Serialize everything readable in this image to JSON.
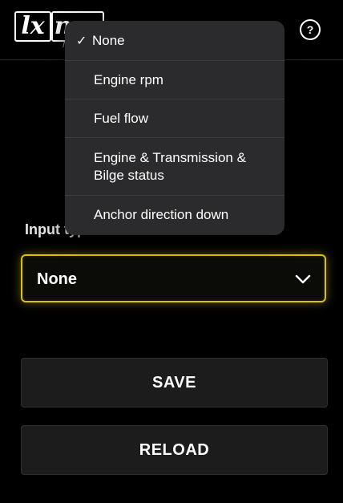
{
  "header": {
    "logo": {
      "primary": "lx",
      "secondary": "nav",
      "sub": "MA"
    },
    "help_icon": "?",
    "accent_color": "#c9a200"
  },
  "menu": {
    "selected_index": 0,
    "check_mark": "✓",
    "items": [
      {
        "label": "None"
      },
      {
        "label": "Engine rpm"
      },
      {
        "label": "Fuel flow"
      },
      {
        "label": "Engine & Transmission & Bilge status"
      },
      {
        "label": "Anchor direction down"
      }
    ]
  },
  "form": {
    "input_type_label": "Input type",
    "select_value": "None",
    "accent_color": "#d9c200"
  },
  "buttons": {
    "save": "SAVE",
    "reload": "RELOAD"
  }
}
